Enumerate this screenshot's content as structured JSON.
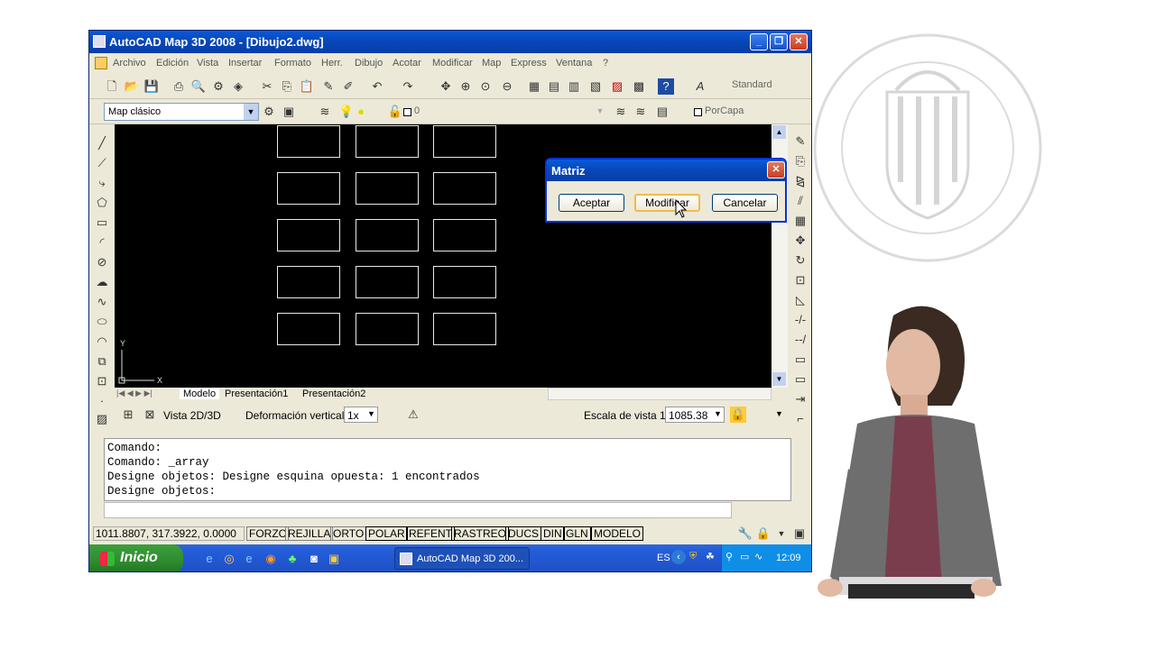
{
  "window": {
    "title": "AutoCAD Map 3D 2008 - [Dibujo2.dwg]"
  },
  "menu": [
    "Archivo",
    "Edición",
    "Vista",
    "Insertar",
    "Formato",
    "Herr.",
    "Dibujo",
    "Acotar",
    "Modificar",
    "Map",
    "Express",
    "Ventana",
    "?"
  ],
  "toolbar": {
    "text_style": "Standard",
    "workspace": "Map clásico",
    "layer": "0",
    "color": "PorCapa"
  },
  "tabs": [
    "Modelo",
    "Presentación1",
    "Presentación2"
  ],
  "view_bar": {
    "view_label": "Vista 2D/3D",
    "deform_label": "Deformación vertical:",
    "deform_value": "1x",
    "scale_label": "Escala de vista 1:",
    "scale_value": "1085.38"
  },
  "command_history": [
    "Comando:",
    "Comando: _array",
    "Designe objetos: Designe esquina opuesta: 1 encontrados",
    "Designe objetos:"
  ],
  "status": {
    "coords": "1011.8807, 317.3922, 0.0000",
    "toggles": [
      "FORZC",
      "REJILLA",
      "ORTO",
      "POLAR",
      "REFENT",
      "RASTREO",
      "DUCS",
      "DIN",
      "GLN",
      "MODELO"
    ]
  },
  "dialog": {
    "title": "Matriz",
    "buttons": [
      "Aceptar",
      "Modificar",
      "Cancelar"
    ]
  },
  "taskbar": {
    "start": "Inicio",
    "item": "AutoCAD Map 3D 200...",
    "lang": "ES",
    "time": "12:09"
  },
  "ucs": {
    "x": "X",
    "y": "Y"
  },
  "seal": {
    "text": "UNIVERSITAT POLITÈCNICA DE VALÈNCIA"
  },
  "colors": {
    "title_blue": "#0846b8",
    "canvas_bg": "#000000",
    "start_green": "#2e8b2e"
  }
}
